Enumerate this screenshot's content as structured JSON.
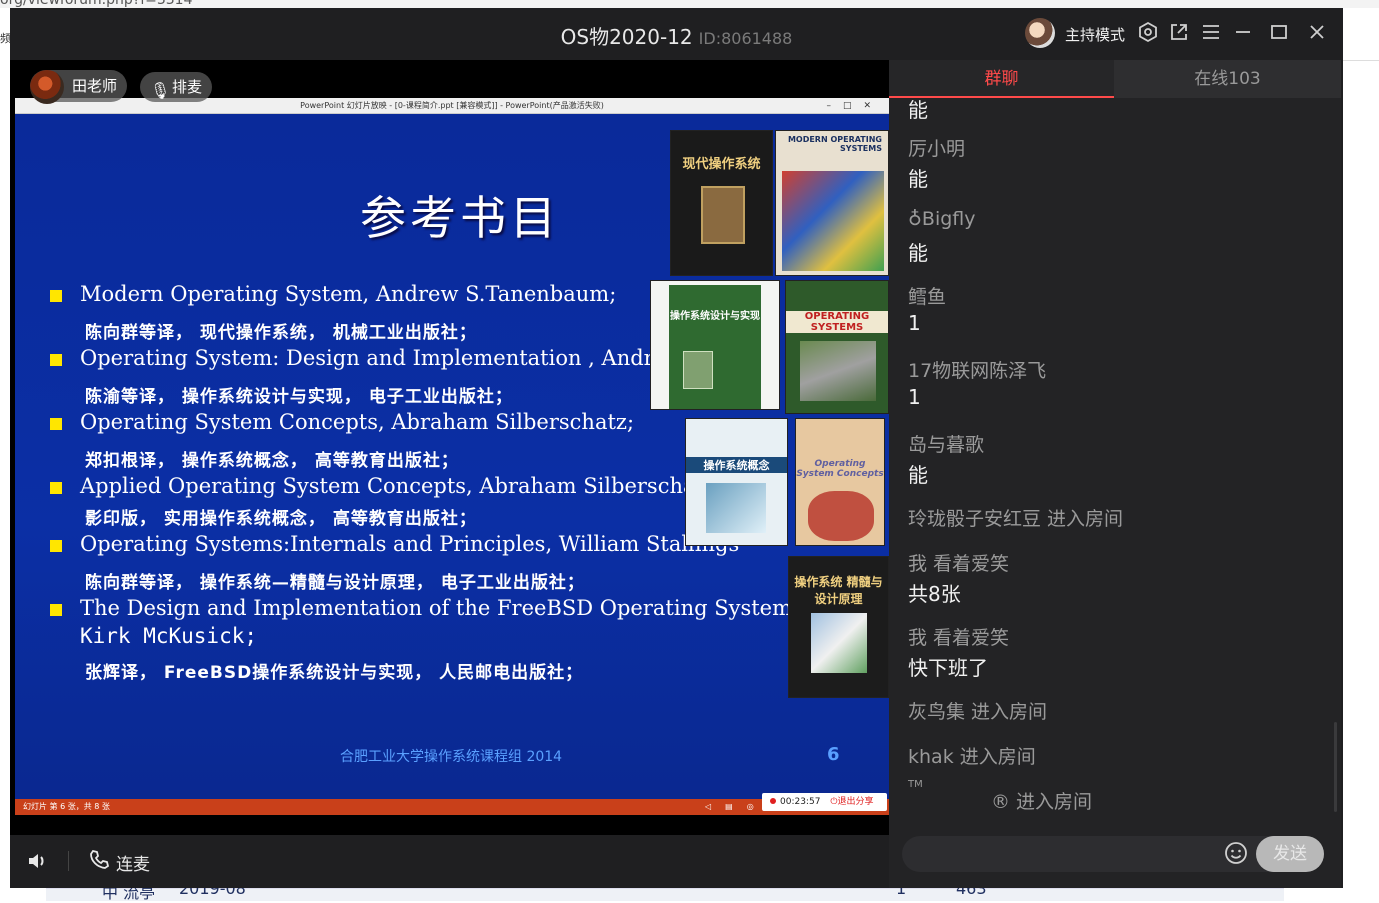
{
  "background": {
    "url_fragment": "org/viewforum.php?f=3314",
    "left_char": "频",
    "bottom_left": "中 流亭",
    "bottom_date": "2019-08",
    "bottom_num1": "1",
    "bottom_num2": "463"
  },
  "window": {
    "title": "OS物2020-12",
    "id_label": "ID:8061488",
    "host_mode": "主持模式"
  },
  "video": {
    "presenter_name": "田老师",
    "mic_label": "排麦",
    "pp_title": "PowerPoint 幻灯片放映 - [0-课程简介.ppt [兼容模式]] - PowerPoint(产品激活失败)",
    "slide": {
      "title": "参考书目",
      "items": [
        {
          "en": "Modern Operating System, Andrew S.Tanenbaum;",
          "cn": "陈向群等译，  现代操作系统，  机械工业出版社；"
        },
        {
          "en": "Operating System: Design and Implementation , Andrew",
          "cn": "陈渝等译，  操作系统设计与实现，  电子工业出版社；"
        },
        {
          "en": "Operating System Concepts,  Abraham Silberschatz;",
          "cn": "郑扣根译，  操作系统概念，  高等教育出版社；"
        },
        {
          "en": "Applied Operating System Concepts, Abraham Silberschatz",
          "cn": "影印版，  实用操作系统概念，  高等教育出版社；"
        },
        {
          "en": "Operating Systems:Internals and Principles, William Stallings",
          "cn": "陈向群等译，  操作系统—精髓与设计原理，  电子工业出版社；"
        },
        {
          "en": "The Design and Implementation of the FreeBSD Operating System,",
          "en2": "Kirk McKusick;",
          "cn": "张辉译，  FreeBSD操作系统设计与实现，  人民邮电出版社；"
        }
      ],
      "footer": "合肥工业大学操作系统课程组 2014",
      "number": "6"
    },
    "books": {
      "b1": "现代操作系统",
      "b2": "MODERN OPERATING SYSTEMS",
      "b3": "操作系统设计与实现",
      "b4": "OPERATING SYSTEMS",
      "b5": "操作系统概念",
      "b6": "Operating System Concepts",
      "b7": "操作系统 精髓与设计原理"
    },
    "pp_status": "幻灯片 第 6 张，共 8 张",
    "share_time": "00:23:57",
    "share_exit": "退出分享"
  },
  "controls": {
    "lianmai": "连麦"
  },
  "chat": {
    "tab_group": "群聊",
    "tab_online": "在线103",
    "messages": [
      {
        "type": "text_only",
        "text": "能"
      },
      {
        "type": "msg",
        "name": "厉小明",
        "text": "能"
      },
      {
        "type": "msg",
        "name": "♁Bigfly",
        "text": "能"
      },
      {
        "type": "msg",
        "name": "鳕鱼",
        "text": "1"
      },
      {
        "type": "msg",
        "name": "17物联网陈泽飞",
        "text": "1"
      },
      {
        "type": "msg",
        "name": "岛与暮歌",
        "text": "能"
      },
      {
        "type": "sys",
        "text": "玲珑骰子安红豆 进入房间"
      },
      {
        "type": "msg",
        "name": "我 看着爱笑",
        "text": "共8张"
      },
      {
        "type": "msg",
        "name": "我 看着爱笑",
        "text": "快下班了"
      },
      {
        "type": "sys",
        "text": "灰鸟集 进入房间"
      },
      {
        "type": "sys",
        "text": "khak 进入房间"
      },
      {
        "type": "sys_tm",
        "tm": "TM",
        "text": "® 进入房间"
      }
    ],
    "send_label": "发送"
  }
}
